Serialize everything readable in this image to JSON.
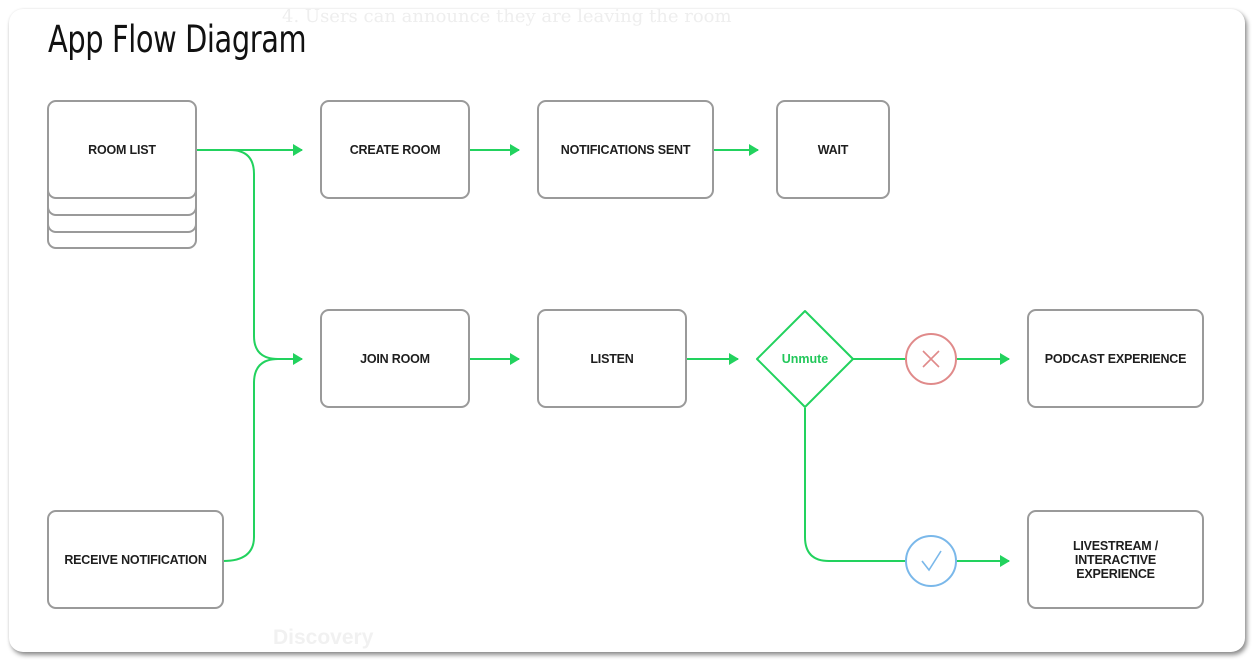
{
  "diagram": {
    "title": "App Flow Diagram",
    "background_text_top": "4. Users can announce they are leaving the room",
    "background_text_bottom": "Discovery",
    "colors": {
      "connector": "#22d25e",
      "node_border": "#9a9a9a",
      "reject": "#e08a8a",
      "accept": "#7ab8ea"
    },
    "nodes": {
      "room_list": "ROOM LIST",
      "create_room": "CREATE ROOM",
      "notifications_sent": "NOTIFICATIONS SENT",
      "wait": "WAIT",
      "join_room": "JOIN ROOM",
      "listen": "LISTEN",
      "receive_notification": "RECEIVE NOTIFICATION",
      "podcast_experience": "PODCAST EXPERIENCE",
      "livestream_line1": "LIVESTREAM /",
      "livestream_line2": "INTERACTIVE",
      "livestream_line3": "EXPERIENCE"
    },
    "decision": {
      "label": "Unmute",
      "no_icon": "x-mark-icon",
      "yes_icon": "check-mark-icon"
    },
    "edges": [
      {
        "from": "ROOM LIST",
        "to": "CREATE ROOM"
      },
      {
        "from": "ROOM LIST",
        "to": "JOIN ROOM"
      },
      {
        "from": "CREATE ROOM",
        "to": "NOTIFICATIONS SENT"
      },
      {
        "from": "NOTIFICATIONS SENT",
        "to": "WAIT"
      },
      {
        "from": "RECEIVE NOTIFICATION",
        "to": "JOIN ROOM"
      },
      {
        "from": "JOIN ROOM",
        "to": "LISTEN"
      },
      {
        "from": "LISTEN",
        "to": "Unmute"
      },
      {
        "from": "Unmute",
        "to": "PODCAST EXPERIENCE",
        "condition": "no"
      },
      {
        "from": "Unmute",
        "to": "LIVESTREAM / INTERACTIVE EXPERIENCE",
        "condition": "yes"
      }
    ]
  }
}
